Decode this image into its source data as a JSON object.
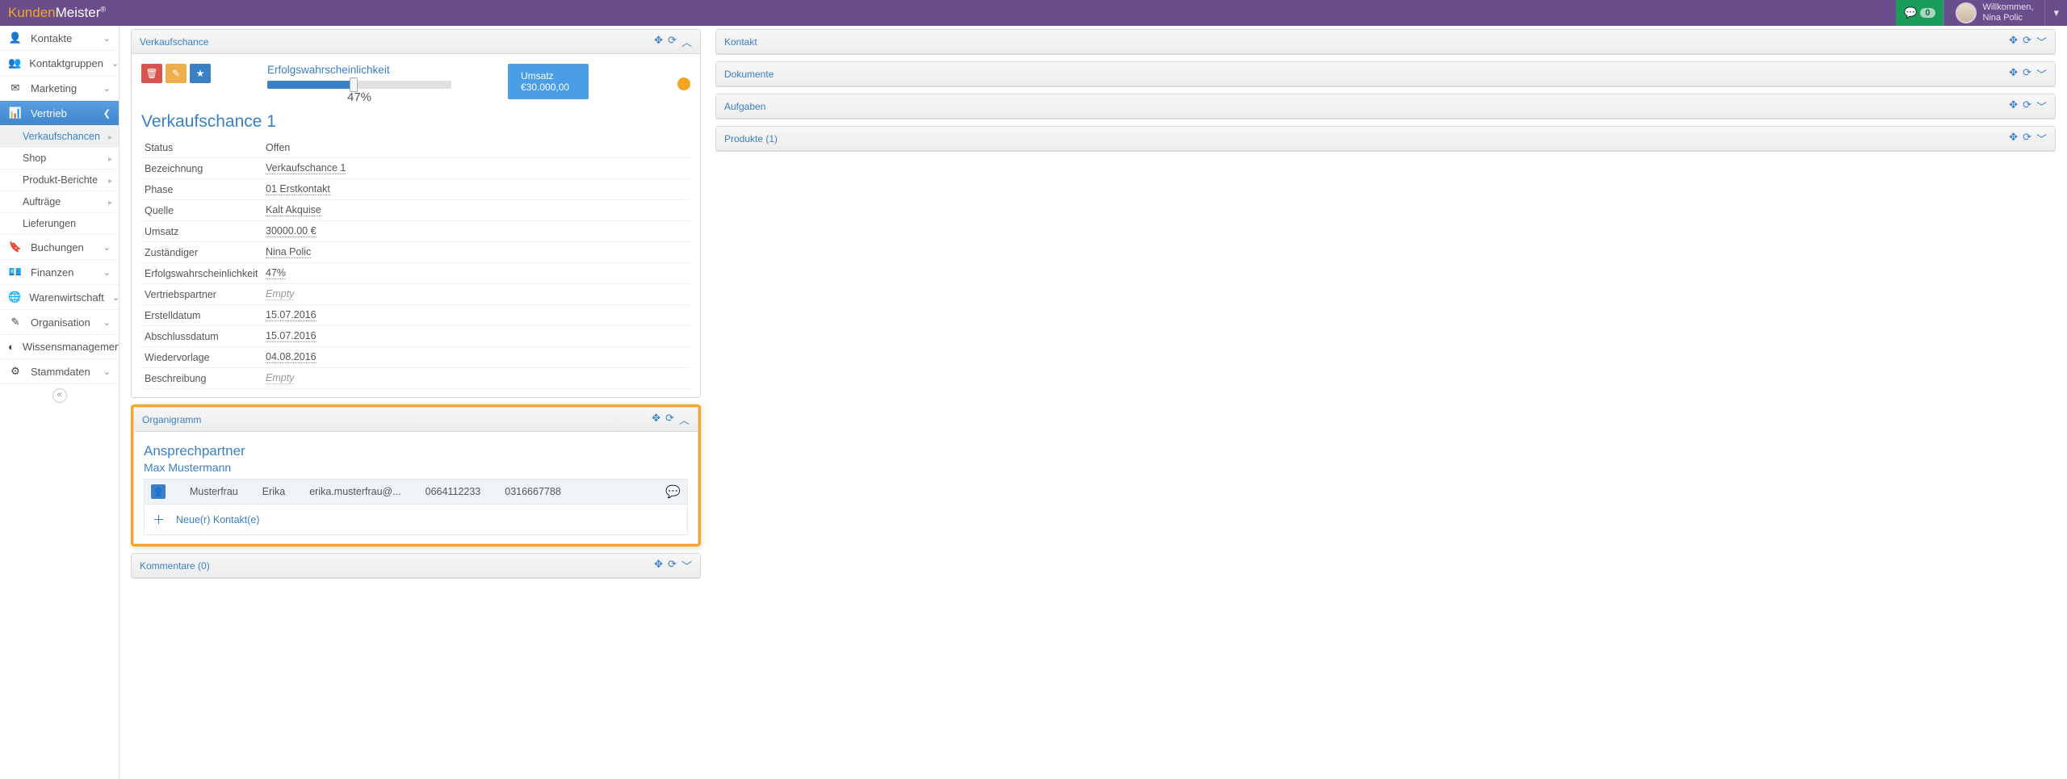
{
  "brand": {
    "part1": "Kunden",
    "part2": "Meister",
    "reg": "®"
  },
  "topbar": {
    "chat_count": "0",
    "welcome": "Willkommen,",
    "username": "Nina Polic"
  },
  "sidebar": {
    "items": [
      {
        "icon": "👤",
        "label": "Kontakte"
      },
      {
        "icon": "👥",
        "label": "Kontaktgruppen"
      },
      {
        "icon": "✉",
        "label": "Marketing"
      }
    ],
    "active": {
      "icon": "📊",
      "label": "Vertrieb"
    },
    "subs": [
      {
        "label": "Verkaufschancen",
        "selected": true,
        "tri": true
      },
      {
        "label": "Shop",
        "tri": true
      },
      {
        "label": "Produkt-Berichte",
        "tri": true
      },
      {
        "label": "Aufträge",
        "tri": true
      },
      {
        "label": "Lieferungen"
      }
    ],
    "rest": [
      {
        "icon": "🔖",
        "label": "Buchungen"
      },
      {
        "icon": "💶",
        "label": "Finanzen"
      },
      {
        "icon": "🌐",
        "label": "Warenwirtschaft"
      },
      {
        "icon": "✎",
        "label": "Organisation"
      },
      {
        "icon": "◐",
        "label": "Wissensmanagement"
      },
      {
        "icon": "⚙",
        "label": "Stammdaten"
      }
    ]
  },
  "main_panel": {
    "title": "Verkaufschance",
    "prob_label": "Erfolgswahrscheinlichkeit",
    "prob_pct_val": 47,
    "prob_pct": "47%",
    "umsatz_label": "Umsatz",
    "umsatz_value": "€30.000,00",
    "page_title": "Verkaufschance 1",
    "props": [
      {
        "k": "Status",
        "v": "Offen"
      },
      {
        "k": "Bezeichnung",
        "v": "Verkaufschance 1",
        "dotted": true
      },
      {
        "k": "Phase",
        "v": "01 Erstkontakt",
        "dotted": true
      },
      {
        "k": "Quelle",
        "v": "Kalt Akquise",
        "dotted": true
      },
      {
        "k": "Umsatz",
        "v": "30000.00 €",
        "dotted": true
      },
      {
        "k": "Zuständiger",
        "v": "Nina Polic",
        "dotted": true
      },
      {
        "k": "Erfolgswahrscheinlichkeit",
        "v": "47%",
        "dotted": true
      },
      {
        "k": "Vertriebspartner",
        "v": "Empty",
        "empty": true
      },
      {
        "k": "Erstelldatum",
        "v": "15.07.2016",
        "dotted": true
      },
      {
        "k": "Abschlussdatum",
        "v": "15.07.2016",
        "dotted": true
      },
      {
        "k": "Wiedervorlage",
        "v": "04.08.2016",
        "dotted": true
      },
      {
        "k": "Beschreibung",
        "v": "Empty",
        "empty": true
      }
    ]
  },
  "org_panel": {
    "title": "Organigramm",
    "sub_title": "Ansprechpartner",
    "person": "Max Mustermann",
    "row": {
      "last": "Musterfrau",
      "first": "Erika",
      "email": "erika.musterfrau@...",
      "phone1": "0664112233",
      "phone2": "0316667788"
    },
    "add_label": "Neue(r) Kontakt(e)"
  },
  "comments_panel": {
    "title": "Kommentare (0)"
  },
  "right_panels": [
    {
      "title": "Kontakt"
    },
    {
      "title": "Dokumente"
    },
    {
      "title": "Aufgaben"
    },
    {
      "title": "Produkte (1)"
    }
  ]
}
